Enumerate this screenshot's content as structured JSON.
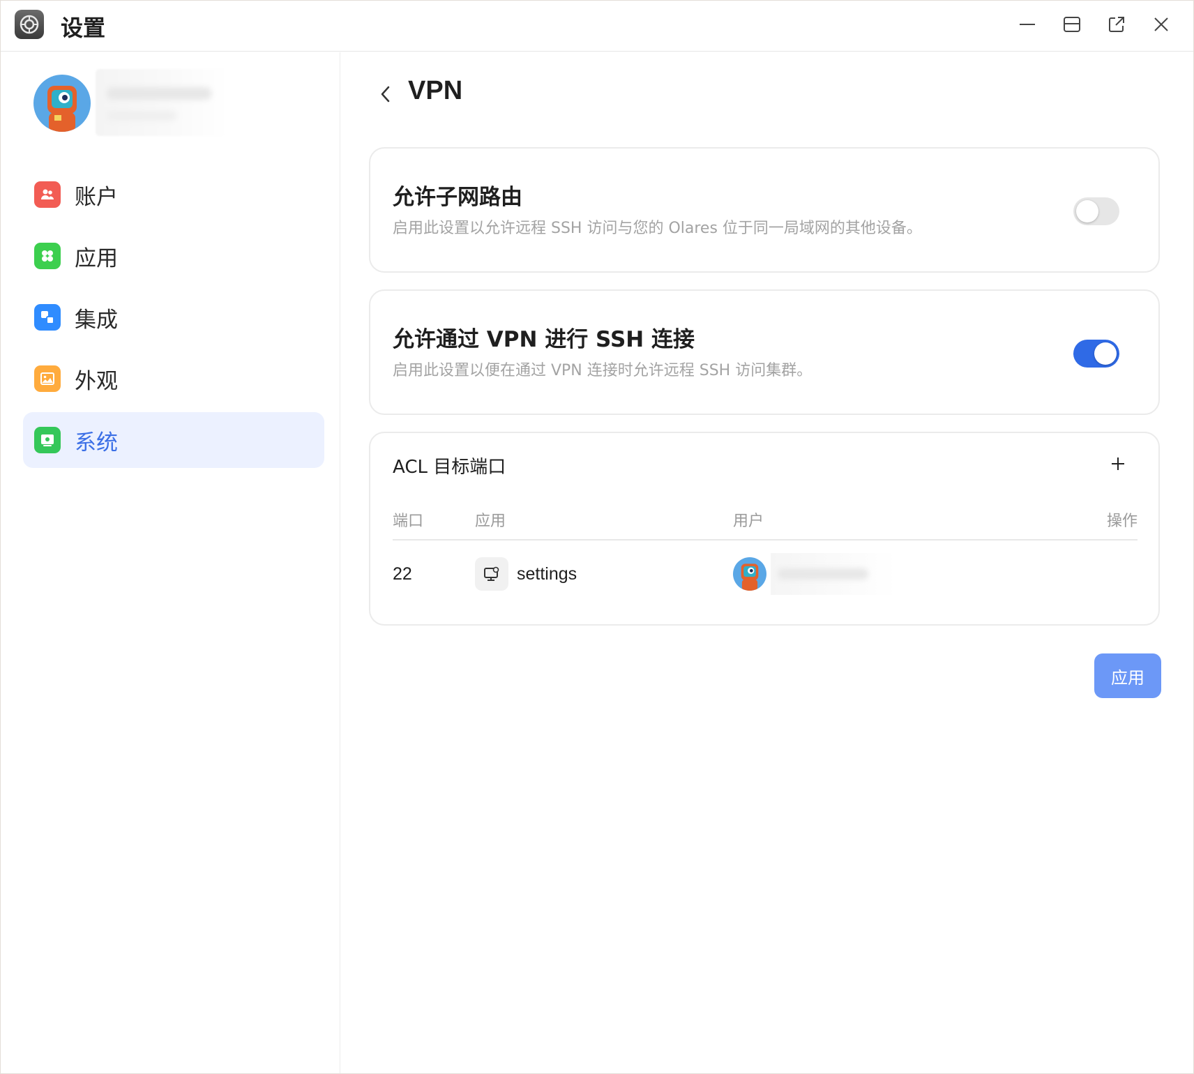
{
  "window": {
    "title": "设置",
    "controls": [
      "minimize-icon",
      "maximize-icon",
      "open-external-icon",
      "close-icon"
    ]
  },
  "sidebar": {
    "items": [
      {
        "label": "账户",
        "icon": "accounts-icon",
        "color": "#f25c54"
      },
      {
        "label": "应用",
        "icon": "apps-icon",
        "color": "#3ccf4e"
      },
      {
        "label": "集成",
        "icon": "integration-icon",
        "color": "#2f8cff"
      },
      {
        "label": "外观",
        "icon": "appearance-icon",
        "color": "#ffab3d"
      },
      {
        "label": "系统",
        "icon": "system-icon",
        "color": "#34c759",
        "active": true
      }
    ]
  },
  "main": {
    "title": "VPN",
    "subnet_routing": {
      "title": "允许子网路由",
      "description": "启用此设置以允许远程 SSH 访问与您的 Olares 位于同一局域网的其他设备。",
      "enabled": false
    },
    "ssh_over_vpn": {
      "title": "允许通过 VPN 进行 SSH 连接",
      "description": "启用此设置以便在通过 VPN 连接时允许远程 SSH 访问集群。",
      "enabled": true
    },
    "acl": {
      "title": "ACL 目标端口",
      "columns": [
        "端口",
        "应用",
        "用户",
        "操作"
      ],
      "rows": [
        {
          "port": "22",
          "app": "settings"
        }
      ]
    },
    "apply_label": "应用"
  },
  "colors": {
    "accent": "#2f6ae6",
    "apply_button": "#6c98f7",
    "active_nav_bg": "#ecf1ff"
  }
}
